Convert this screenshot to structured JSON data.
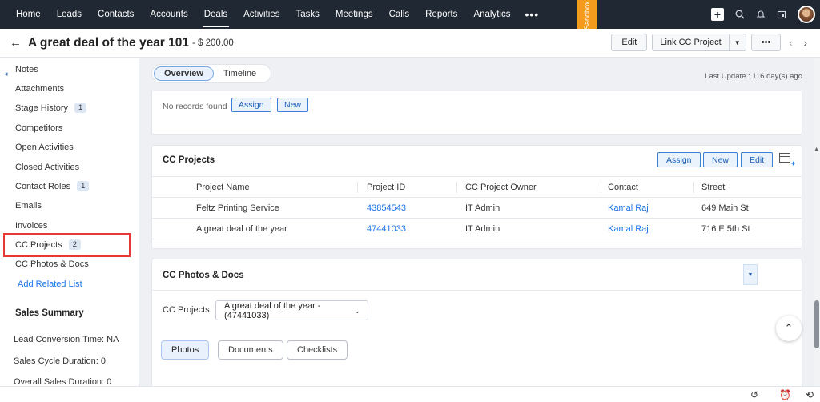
{
  "nav": {
    "items": [
      "Home",
      "Leads",
      "Contacts",
      "Accounts",
      "Deals",
      "Activities",
      "Tasks",
      "Meetings",
      "Calls",
      "Reports",
      "Analytics"
    ],
    "active": "Deals",
    "more_label": "•••",
    "sandbox_label": "Sandbox",
    "icons": [
      "plus-icon",
      "search-icon",
      "bell-icon",
      "calendar-icon",
      "avatar"
    ]
  },
  "header": {
    "title": "A great deal of the year 101",
    "amount": "- $ 200.00",
    "edit_label": "Edit",
    "link_project_label": "Link CC Project",
    "more_label": "•••"
  },
  "sidebar": {
    "items": [
      {
        "label": "Notes"
      },
      {
        "label": "Attachments"
      },
      {
        "label": "Stage History",
        "badge": "1"
      },
      {
        "label": "Competitors"
      },
      {
        "label": "Open Activities"
      },
      {
        "label": "Closed Activities"
      },
      {
        "label": "Contact Roles",
        "badge": "1"
      },
      {
        "label": "Emails"
      },
      {
        "label": "Invoices"
      },
      {
        "label": "CC Projects",
        "badge": "2"
      },
      {
        "label": "CC Photos & Docs"
      }
    ],
    "add_related": "Add Related List",
    "sales_summary": {
      "title": "Sales Summary",
      "lines": [
        "Lead Conversion Time: NA",
        "Sales Cycle Duration: 0",
        "Overall Sales Duration: 0"
      ]
    }
  },
  "main": {
    "tabs": [
      "Overview",
      "Timeline"
    ],
    "last_update": "Last Update : 116 day(s) ago",
    "prev_section": {
      "empty_text": "No records found",
      "assign_label": "Assign",
      "new_label": "New"
    },
    "cc_projects": {
      "title": "CC Projects",
      "assign_label": "Assign",
      "new_label": "New",
      "edit_label": "Edit",
      "columns": [
        "Project Name",
        "Project ID",
        "CC Project Owner",
        "Contact",
        "Street"
      ],
      "rows": [
        [
          "Feltz Printing Service",
          "43854543",
          "IT Admin",
          "Kamal Raj",
          "649 Main St"
        ],
        [
          "A great deal of the year",
          "47441033",
          "IT Admin",
          "Kamal Raj",
          "716 E 5th St"
        ]
      ]
    },
    "cc_photos": {
      "title": "CC Photos & Docs",
      "projects_label": "CC Projects:",
      "selected_project": "A great deal of the year - (47441033)",
      "tabs": [
        "Photos",
        "Documents",
        "Checklists"
      ]
    }
  }
}
